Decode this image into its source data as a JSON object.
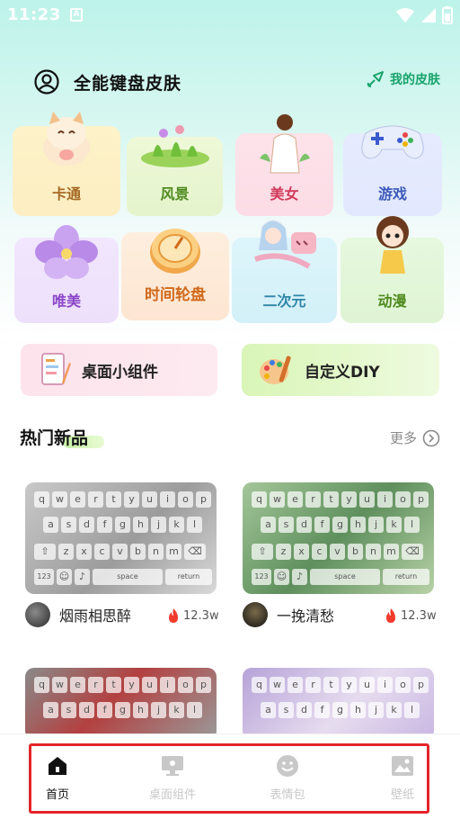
{
  "status_bar": {
    "time": "11:23",
    "notif_letter": "A"
  },
  "header": {
    "title": "全能键盘皮肤",
    "my_skin_label": "我的皮肤"
  },
  "categories": [
    {
      "label": "卡通",
      "color": "#a56a22"
    },
    {
      "label": "风景",
      "color": "#4f8a1e"
    },
    {
      "label": "美女",
      "color": "#d03a5a"
    },
    {
      "label": "游戏",
      "color": "#3a58b8"
    },
    {
      "label": "唯美",
      "color": "#8b45c8"
    },
    {
      "label": "时间轮盘",
      "color": "#d06a1c"
    },
    {
      "label": "二次元",
      "color": "#2f86a8"
    },
    {
      "label": "动漫",
      "color": "#4f8a1e"
    }
  ],
  "widgets": {
    "desktop_widget": "桌面小组件",
    "custom_diy": "自定义DIY"
  },
  "section": {
    "title": "热门新品",
    "more": "更多"
  },
  "keyboard_keys": {
    "row1": [
      "q",
      "w",
      "e",
      "r",
      "t",
      "y",
      "u",
      "i",
      "o",
      "p"
    ],
    "row2": [
      "a",
      "s",
      "d",
      "f",
      "g",
      "h",
      "j",
      "k",
      "l"
    ],
    "row3": [
      "z",
      "x",
      "c",
      "v",
      "b",
      "n",
      "m"
    ],
    "fn_123": "123",
    "space": "space",
    "return": "return"
  },
  "products": [
    {
      "author": "烟雨相思醉",
      "heat": "12.3w"
    },
    {
      "author": "一挽清愁",
      "heat": "12.3w"
    }
  ],
  "bottom_nav": [
    {
      "label": "首页",
      "active": true
    },
    {
      "label": "桌面组件",
      "active": false
    },
    {
      "label": "表情包",
      "active": false
    },
    {
      "label": "壁纸",
      "active": false
    }
  ],
  "colors": {
    "accent_green": "#18a36b",
    "nav_active": "#111111",
    "nav_inactive": "#c8c8c8",
    "highlight_red": "#e3252a"
  }
}
